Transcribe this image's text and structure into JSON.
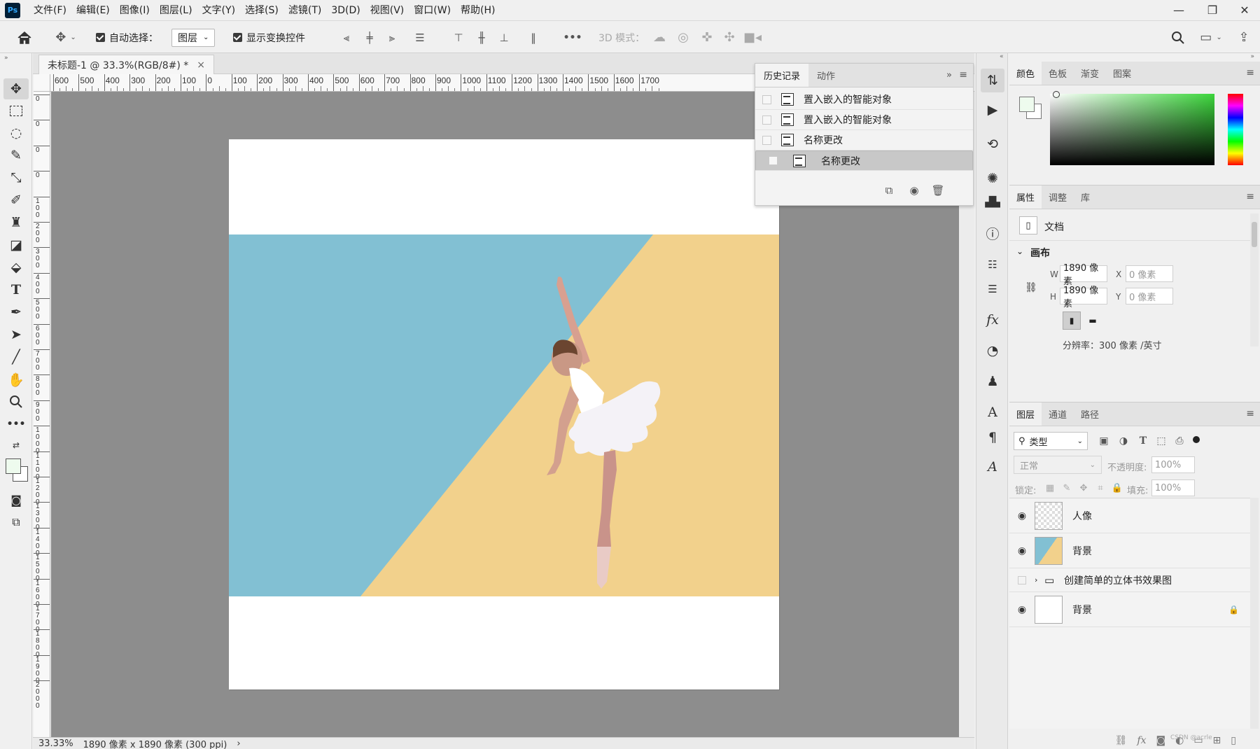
{
  "menubar": {
    "logo": "Ps",
    "items": [
      "文件(F)",
      "编辑(E)",
      "图像(I)",
      "图层(L)",
      "文字(Y)",
      "选择(S)",
      "滤镜(T)",
      "3D(D)",
      "视图(V)",
      "窗口(W)",
      "帮助(H)"
    ],
    "window_controls": {
      "minimize": "—",
      "restore": "❐",
      "close": "✕"
    }
  },
  "options": {
    "auto_select_label": "自动选择：",
    "auto_select_target": "图层",
    "show_transform_label": "显示变换控件",
    "three_d_mode_label": "3D 模式：",
    "more": "•••"
  },
  "document": {
    "tab_title": "未标题-1 @ 33.3%(RGB/8#) *",
    "close": "×",
    "ruler_h": [
      "600",
      "500",
      "400",
      "300",
      "200",
      "100",
      "0",
      "100",
      "200",
      "300",
      "400",
      "500",
      "600",
      "700",
      "800",
      "900",
      "1000",
      "1100",
      "1200",
      "1300",
      "1400",
      "1500",
      "1600",
      "1700"
    ],
    "ruler_v": [
      "0",
      "0",
      "0",
      "0",
      "100",
      "200",
      "300",
      "400",
      "500",
      "600",
      "700",
      "800",
      "900",
      "1000",
      "1100",
      "1200",
      "1300",
      "1400",
      "1500",
      "1600",
      "1700",
      "1800",
      "1900",
      "2000"
    ],
    "status_zoom": "33.33%",
    "status_info": "1890 像素 x 1890 像素 (300 ppi)",
    "status_arrow": "›",
    "colors": {
      "blue": "#82c0d3",
      "yellow": "#f2d18c",
      "paper": "#ffffff",
      "pasteboard": "#8d8d8d"
    }
  },
  "history": {
    "tabs": [
      "历史记录",
      "动作"
    ],
    "items": [
      "置入嵌入的智能对象",
      "置入嵌入的智能对象",
      "名称更改",
      "名称更改"
    ],
    "selected_index": 3
  },
  "color_panel": {
    "tabs": [
      "颜色",
      "色板",
      "渐变",
      "图案"
    ],
    "hue": "#3cd63c"
  },
  "properties": {
    "tabs": [
      "属性",
      "调整",
      "库"
    ],
    "doc_label": "文档",
    "section": "画布",
    "w_label": "W",
    "w_value": "1890 像素",
    "h_label": "H",
    "h_value": "1890 像素",
    "x_label": "X",
    "x_value": "0 像素",
    "y_label": "Y",
    "y_value": "0 像素",
    "resolution": "分辨率：300 像素 /英寸"
  },
  "layers_panel": {
    "tabs": [
      "图层",
      "通道",
      "路径"
    ],
    "filter_kind": "类型",
    "blend_mode": "正常",
    "opacity_label": "不透明度:",
    "opacity_value": "100%",
    "lock_label": "锁定:",
    "fill_label": "填充:",
    "fill_value": "100%",
    "layers": [
      {
        "name": "人像",
        "visible": true
      },
      {
        "name": "背景",
        "visible": true
      },
      {
        "name": "创建简单的立体书效果图",
        "visible": false,
        "group": true
      },
      {
        "name": "背景",
        "visible": true,
        "locked": true
      }
    ],
    "footer_icons": [
      "link-icon",
      "fx-icon",
      "mask-icon",
      "adjustment-icon",
      "folder-icon",
      "new-layer-icon",
      "trash-icon"
    ],
    "watermark": "CSDN @acrle"
  }
}
